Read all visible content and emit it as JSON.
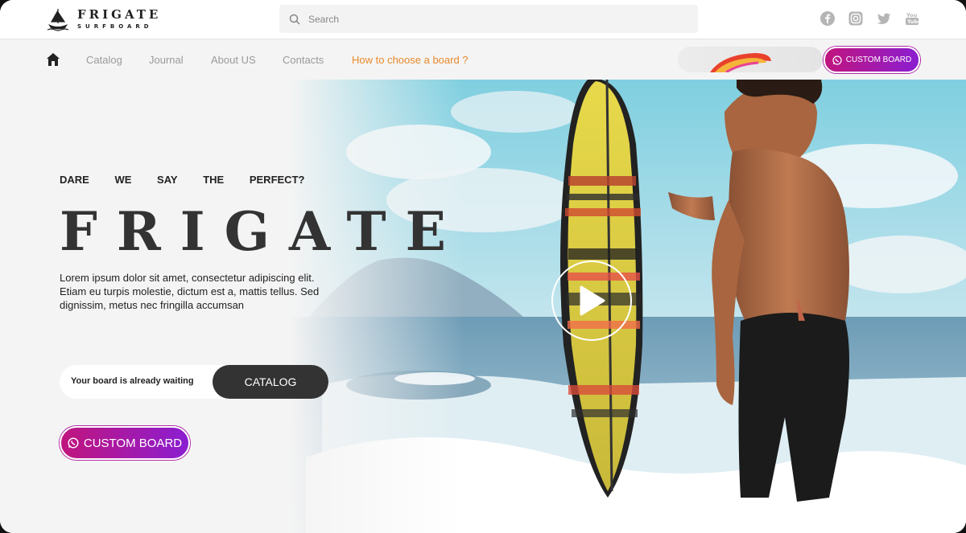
{
  "brand": {
    "title": "FRIGATE",
    "subtitle": "SURFBOARD"
  },
  "search": {
    "placeholder": "Search"
  },
  "socials": [
    "facebook-icon",
    "instagram-icon",
    "twitter-icon",
    "youtube-icon"
  ],
  "nav": {
    "items": [
      {
        "label": "Catalog"
      },
      {
        "label": "Journal"
      },
      {
        "label": "About US"
      },
      {
        "label": "Contacts"
      },
      {
        "label": "How to choose a board ?"
      }
    ],
    "cta_label": "CUSTOM BOARD"
  },
  "hero": {
    "tagline": [
      "DARE",
      "WE",
      "SAY",
      "THE",
      "PERFECT?"
    ],
    "title": "FRIGATE",
    "description": "Lorem ipsum dolor sit amet, consectetur adipiscing elit. Etiam eu turpis molestie, dictum est a, mattis tellus. Sed dignissim, metus nec fringilla accumsan",
    "catalog_prompt": "Your board is already waiting",
    "catalog_button": "CATALOG",
    "cta_label": "CUSTOM BOARD"
  },
  "colors": {
    "accent_orange": "#e9892b",
    "cta_start": "#c0157e",
    "cta_end": "#8b1ed1",
    "dark_button": "#333333"
  }
}
